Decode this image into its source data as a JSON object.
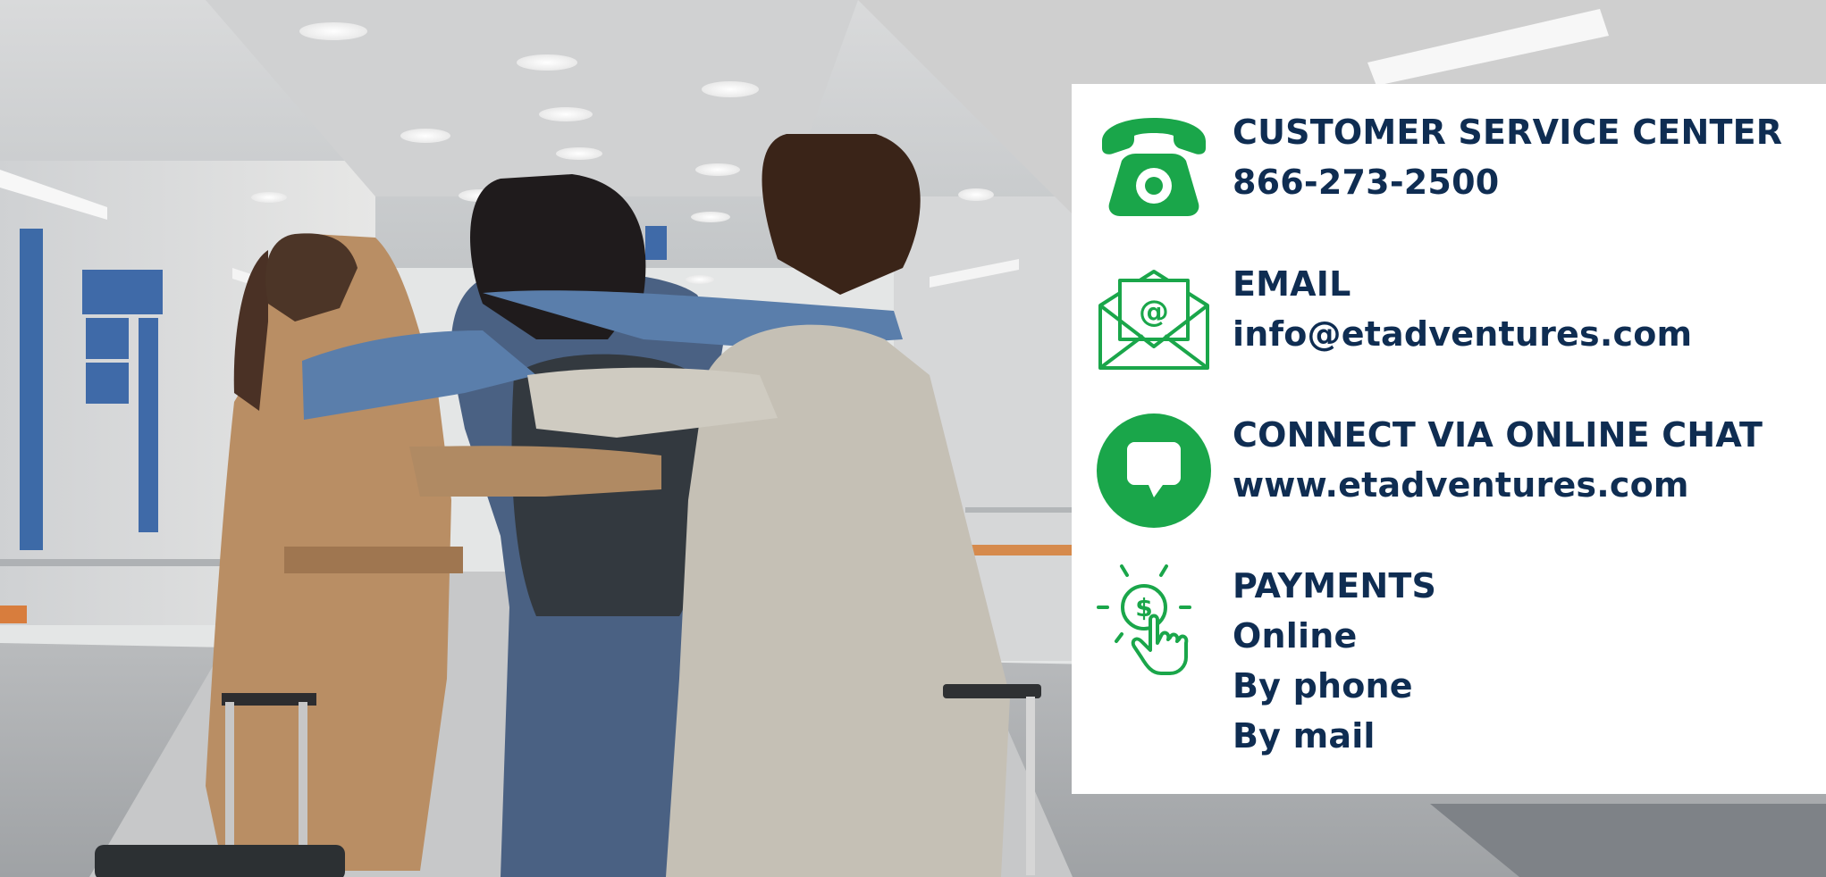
{
  "colors": {
    "brand_green": "#1aa64a",
    "brand_navy": "#0f2d52",
    "panel_bg": "#ffffff"
  },
  "contact": {
    "phone": {
      "icon": "telephone-icon",
      "heading": "CUSTOMER SERVICE CENTER",
      "value": "866-273-2500"
    },
    "email": {
      "icon": "envelope-at-icon",
      "heading": "EMAIL",
      "value": "info@etadventures.com"
    },
    "chat": {
      "icon": "chat-bubble-icon",
      "heading": "CONNECT VIA ONLINE CHAT",
      "value": "www.etadventures.com"
    },
    "payments": {
      "icon": "dollar-tap-icon",
      "heading": "PAYMENTS",
      "lines": [
        "Online",
        "By phone",
        "By mail"
      ]
    }
  }
}
